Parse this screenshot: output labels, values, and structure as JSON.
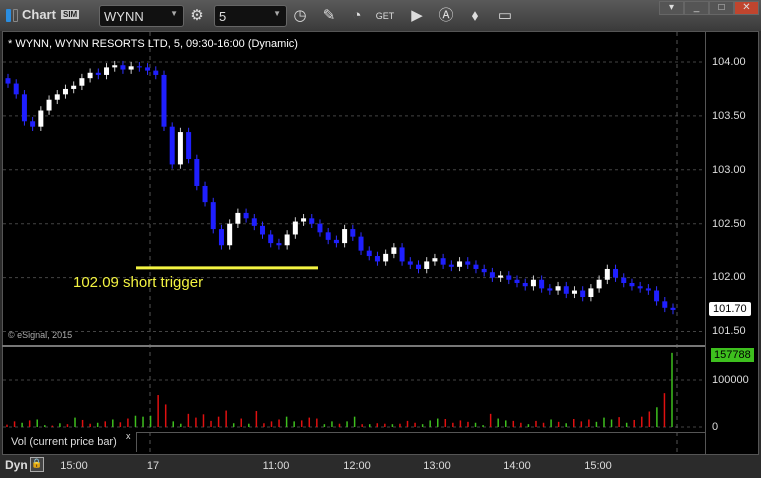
{
  "window": {
    "title": "Chart",
    "badge": "SIM",
    "symbol": "WYNN",
    "interval": "5"
  },
  "toolbar_icons": [
    "settings-icon",
    "clock-icon",
    "pencil-icon",
    "indicator-icon",
    "get-icon",
    "play-icon",
    "alert-icon",
    "ticket-icon",
    "comment-icon"
  ],
  "chart": {
    "header": "* WYNN, WYNN RESORTS LTD, 5, 09:30-16:00 (Dynamic)",
    "credit": "© eSignal, 2015",
    "annotation": "102.09 short trigger",
    "price_labels": [
      "104.00",
      "103.50",
      "103.00",
      "102.50",
      "102.00",
      "101.50"
    ],
    "last_price": "101.70",
    "volume_labels": [
      "100000",
      "0"
    ],
    "last_volume": "157788",
    "volume_study": "Vol (current price bar)",
    "volume_close": "x",
    "dyn": "Dyn",
    "time_labels": [
      "15:00",
      "17",
      "11:00",
      "12:00",
      "13:00",
      "14:00",
      "15:00"
    ],
    "colors": {
      "up": "#ffffff",
      "down": "#1f1fff",
      "vol_up": "#3ec01e",
      "vol_down": "#e01010",
      "trigger": "#f4f442"
    }
  },
  "chart_data": {
    "type": "candlestick",
    "ylim": [
      101.4,
      104.3
    ],
    "trigger_level": 102.09,
    "first_open": 103.85,
    "closes": [
      103.8,
      103.7,
      103.45,
      103.4,
      103.55,
      103.65,
      103.7,
      103.75,
      103.78,
      103.85,
      103.9,
      103.88,
      103.95,
      103.97,
      103.93,
      103.96,
      103.95,
      103.92,
      103.88,
      103.4,
      103.05,
      103.35,
      103.1,
      102.85,
      102.7,
      102.45,
      102.3,
      102.5,
      102.6,
      102.55,
      102.48,
      102.4,
      102.32,
      102.3,
      102.4,
      102.52,
      102.55,
      102.5,
      102.42,
      102.35,
      102.32,
      102.45,
      102.38,
      102.25,
      102.2,
      102.15,
      102.22,
      102.28,
      102.15,
      102.12,
      102.08,
      102.15,
      102.18,
      102.12,
      102.1,
      102.15,
      102.12,
      102.08,
      102.05,
      102.0,
      102.02,
      101.98,
      101.95,
      101.92,
      101.98,
      101.9,
      101.88,
      101.92,
      101.85,
      101.88,
      101.82,
      101.9,
      101.98,
      102.08,
      102.0,
      101.95,
      101.92,
      101.9,
      101.88,
      101.78,
      101.72,
      101.7
    ],
    "volumes": [
      5000,
      12000,
      9000,
      14000,
      16000,
      4000,
      3000,
      8000,
      6000,
      20000,
      15000,
      7000,
      9000,
      12000,
      16000,
      10000,
      18000,
      24000,
      22000,
      24000,
      68000,
      48000,
      12000,
      7000,
      28000,
      20000,
      27000,
      13000,
      22000,
      35000,
      8000,
      18000,
      7000,
      34000,
      8000,
      12000,
      16000,
      22000,
      12000,
      14000,
      20000,
      18000,
      6000,
      12000,
      7000,
      12000,
      22000,
      6000,
      6000,
      8000,
      7000,
      6000,
      7000,
      13000,
      9000,
      6000,
      14000,
      18000,
      17000,
      9000,
      14000,
      11000,
      9000,
      4000,
      28000,
      18000,
      14000,
      13000,
      9000,
      6000,
      13000,
      9000,
      16000,
      11000,
      8000,
      17000,
      12000,
      16000,
      11000,
      20000,
      16000,
      21000,
      9000,
      15000,
      22000,
      33000,
      42000,
      72000,
      157788
    ],
    "volume_up": [
      0,
      0,
      1,
      0,
      1,
      1,
      0,
      1,
      0,
      1,
      0,
      0,
      1,
      0,
      1,
      0,
      0,
      1,
      1,
      1,
      0,
      0,
      1,
      1,
      0,
      0,
      0,
      0,
      0,
      0,
      1,
      0,
      1,
      0,
      0,
      0,
      0,
      1,
      1,
      0,
      0,
      0,
      1,
      1,
      0,
      1,
      1,
      0,
      1,
      0,
      0,
      1,
      0,
      0,
      0,
      1,
      1,
      1,
      0,
      0,
      0,
      0,
      1,
      1,
      0,
      1,
      1,
      0,
      0,
      1,
      0,
      0,
      1,
      0,
      1,
      0,
      0,
      0,
      1,
      1,
      1,
      0,
      1,
      0,
      0,
      0,
      1,
      0,
      1
    ],
    "volume_ylim": [
      0,
      165000
    ]
  }
}
